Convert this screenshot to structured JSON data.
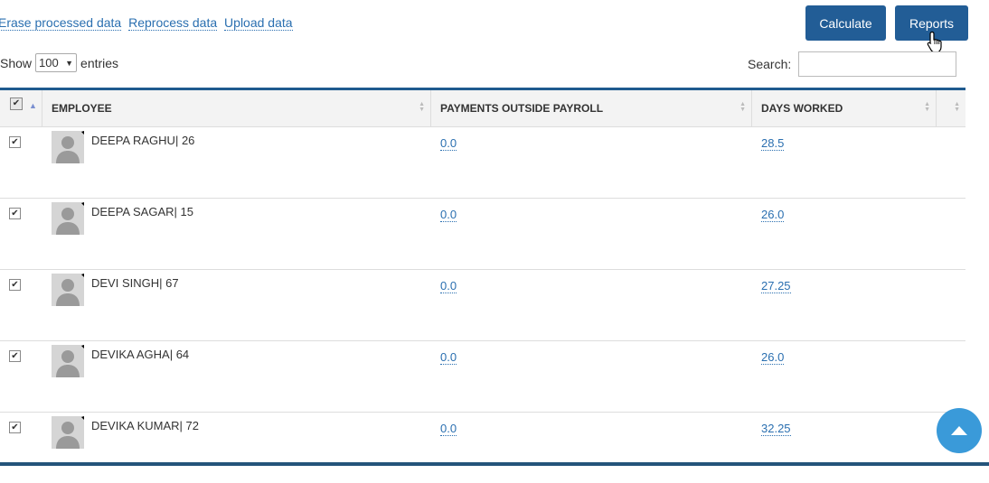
{
  "toolbar": {
    "links": [
      "Erase processed data",
      "Reprocess data",
      "Upload data"
    ],
    "calculate_label": "Calculate",
    "reports_label": "Reports"
  },
  "length": {
    "show_label": "Show",
    "value": "100",
    "entries_label": "entries"
  },
  "search": {
    "label": "Search:",
    "value": ""
  },
  "table": {
    "headers": [
      "EMPLOYEE",
      "PAYMENTS OUTSIDE PAYROLL",
      "DAYS WORKED"
    ],
    "rows": [
      {
        "checked": true,
        "employee": "DEEPA RAGHU| 26",
        "payments": "0.0",
        "days": "28.5"
      },
      {
        "checked": true,
        "employee": "DEEPA SAGAR| 15",
        "payments": "0.0",
        "days": "26.0"
      },
      {
        "checked": true,
        "employee": "DEVI SINGH| 67",
        "payments": "0.0",
        "days": "27.25"
      },
      {
        "checked": true,
        "employee": "DEVIKA AGHA| 64",
        "payments": "0.0",
        "days": "26.0"
      },
      {
        "checked": true,
        "employee": "DEVIKA KUMAR| 72",
        "payments": "0.0",
        "days": "32.25"
      }
    ]
  },
  "icons": {
    "checkbox": "checkmark",
    "avatar": "person-silhouette-icon",
    "scroll_top": "caret-up-icon",
    "cursor": "hand-pointer-icon"
  },
  "colors": {
    "primary": "#225d96",
    "link": "#2a6fb0",
    "scroll_button": "#3a9ad9"
  }
}
